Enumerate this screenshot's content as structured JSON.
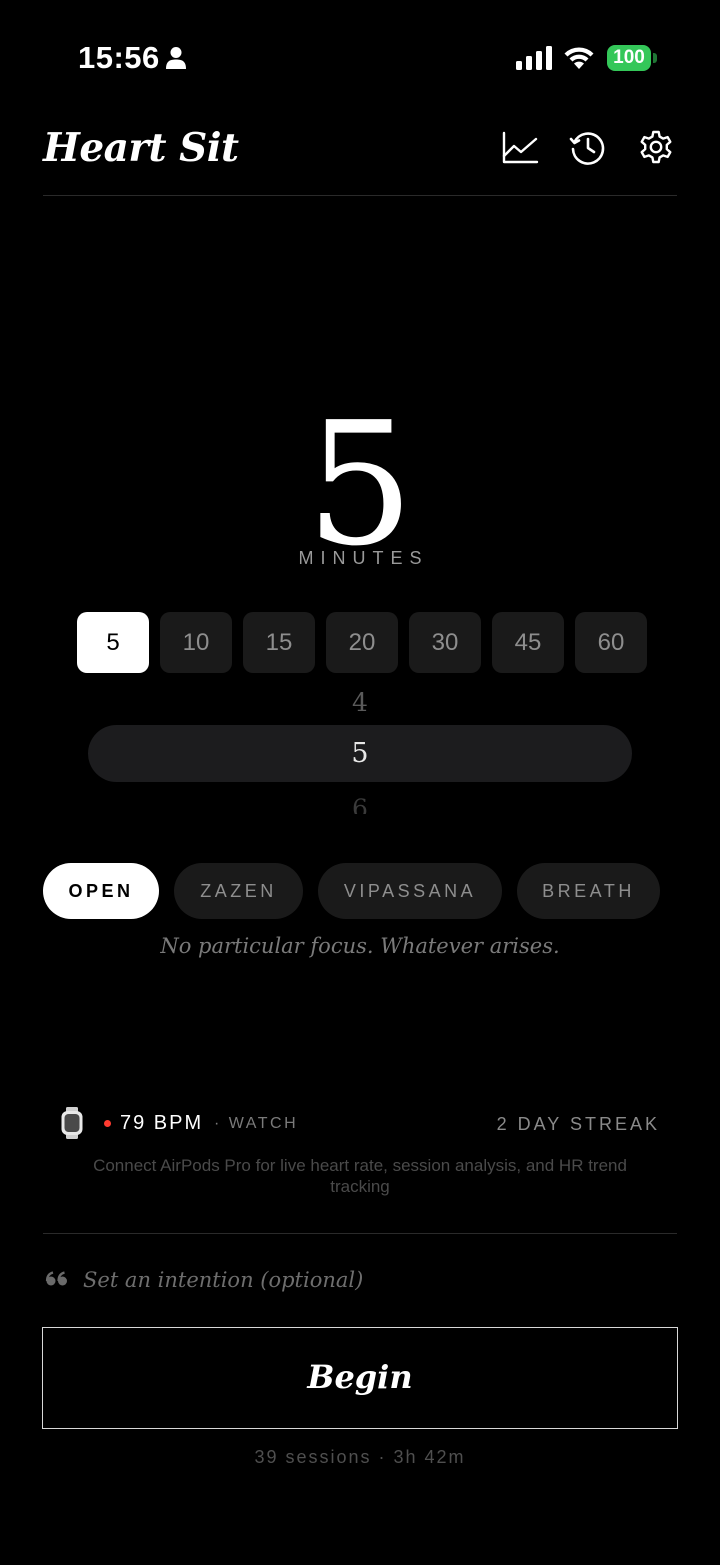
{
  "status_bar": {
    "time": "15:56",
    "battery": "100"
  },
  "header": {
    "title": "Heart Sit",
    "icons": [
      "chart-icon",
      "history-icon",
      "gear-icon"
    ]
  },
  "timer": {
    "value": "5",
    "unit_label": "MINUTES"
  },
  "presets": [
    {
      "label": "5",
      "selected": true
    },
    {
      "label": "10",
      "selected": false
    },
    {
      "label": "15",
      "selected": false
    },
    {
      "label": "20",
      "selected": false
    },
    {
      "label": "30",
      "selected": false
    },
    {
      "label": "45",
      "selected": false
    },
    {
      "label": "60",
      "selected": false
    }
  ],
  "picker": {
    "prev": "4",
    "current": "5",
    "next": "6"
  },
  "modes": [
    {
      "label": "OPEN",
      "selected": true
    },
    {
      "label": "ZAZEN",
      "selected": false
    },
    {
      "label": "VIPASSANA",
      "selected": false
    },
    {
      "label": "BREATH",
      "selected": false
    }
  ],
  "mode_description": "No particular focus. Whatever arises.",
  "heart_rate": {
    "value": "79 BPM",
    "source": "· WATCH",
    "streak": "2 DAY STREAK",
    "connect_message": "Connect AirPods Pro for live heart rate, session analysis, and HR trend tracking"
  },
  "intention": {
    "placeholder": "Set an intention (optional)",
    "value": ""
  },
  "begin_label": "Begin",
  "session_stats": "39 sessions · 3h 42m",
  "colors": {
    "background": "#000000",
    "battery": "#34c759",
    "hr_dot": "#ff3b30"
  }
}
